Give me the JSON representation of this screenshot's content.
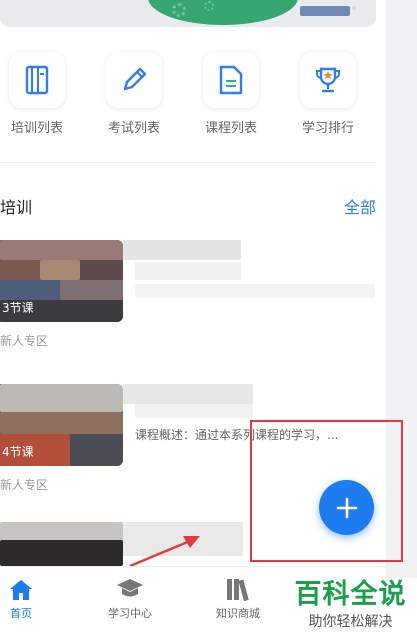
{
  "quick_menu": [
    {
      "label": "培训列表",
      "icon": "training-list-icon"
    },
    {
      "label": "考试列表",
      "icon": "pencil-icon"
    },
    {
      "label": "课程列表",
      "icon": "document-icon"
    },
    {
      "label": "学习排行",
      "icon": "trophy-icon"
    }
  ],
  "section": {
    "title": "培训",
    "all_label": "全部"
  },
  "courses": [
    {
      "lessons": "3节课",
      "tag": "新人专区",
      "desc": ""
    },
    {
      "lessons": "4节课",
      "tag": "新人专区",
      "desc": "课程概述：通过本系列课程的学习，..."
    }
  ],
  "nav": [
    {
      "label": "首页",
      "icon": "home-icon",
      "active": true
    },
    {
      "label": "学习中心",
      "icon": "graduation-cap-icon",
      "active": false
    },
    {
      "label": "知识商城",
      "icon": "books-icon",
      "active": false
    }
  ],
  "watermark": {
    "title": "百科全说",
    "subtitle": "助你轻松解决"
  },
  "colors": {
    "accent": "#1c7cf0",
    "link": "#2f7fe8",
    "highlight": "#e33b3b",
    "watermark": "#1aa04a"
  }
}
